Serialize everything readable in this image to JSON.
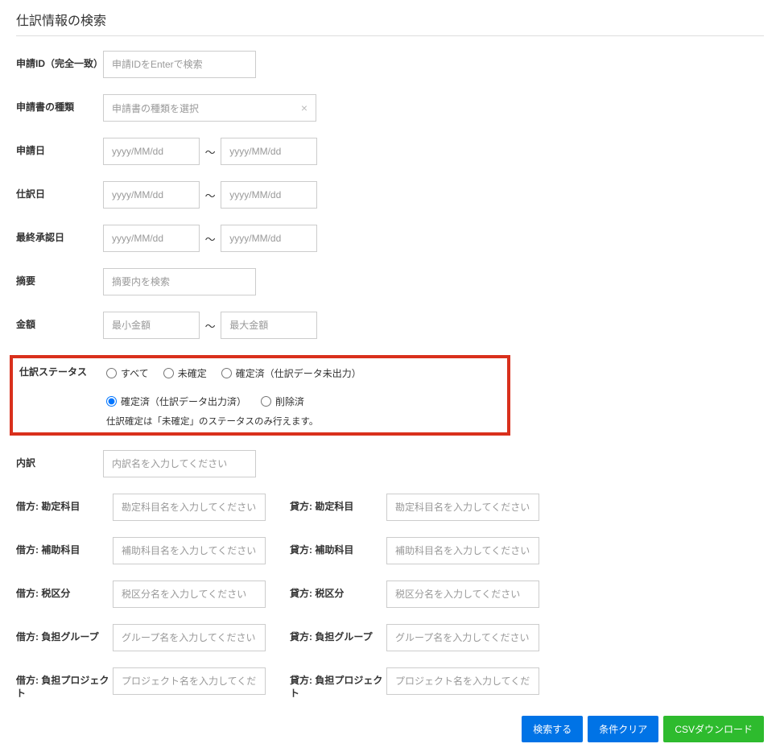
{
  "page_title": "仕訳情報の検索",
  "fields": {
    "request_id": {
      "label": "申請ID（完全一致）",
      "placeholder": "申請IDをEnterで検索"
    },
    "request_type": {
      "label": "申請書の種類",
      "placeholder": "申請書の種類を選択"
    },
    "request_date": {
      "label": "申請日",
      "from_ph": "yyyy/MM/dd",
      "to_ph": "yyyy/MM/dd"
    },
    "journal_date": {
      "label": "仕訳日",
      "from_ph": "yyyy/MM/dd",
      "to_ph": "yyyy/MM/dd"
    },
    "final_approval_date": {
      "label": "最終承認日",
      "from_ph": "yyyy/MM/dd",
      "to_ph": "yyyy/MM/dd"
    },
    "summary": {
      "label": "摘要",
      "placeholder": "摘要内を検索"
    },
    "amount": {
      "label": "金額",
      "min_ph": "最小金額",
      "max_ph": "最大金額"
    },
    "status": {
      "label": "仕訳ステータス",
      "options": {
        "all": "すべて",
        "unconfirmed": "未確定",
        "confirmed_not_exported": "確定済（仕訳データ未出力）",
        "confirmed_exported": "確定済（仕訳データ出力済）",
        "deleted": "削除済"
      },
      "note": "仕訳確定は「未確定」のステータスのみ行えます。"
    },
    "breakdown": {
      "label": "内訳",
      "placeholder": "内訳名を入力してください"
    },
    "debit_account": {
      "label": "借方: 勘定科目",
      "placeholder": "勘定科目名を入力してください"
    },
    "credit_account": {
      "label": "貸方: 勘定科目",
      "placeholder": "勘定科目名を入力してください"
    },
    "debit_subaccount": {
      "label": "借方: 補助科目",
      "placeholder": "補助科目名を入力してください"
    },
    "credit_subaccount": {
      "label": "貸方: 補助科目",
      "placeholder": "補助科目名を入力してください"
    },
    "debit_tax": {
      "label": "借方: 税区分",
      "placeholder": "税区分名を入力してください"
    },
    "credit_tax": {
      "label": "貸方: 税区分",
      "placeholder": "税区分名を入力してください"
    },
    "debit_group": {
      "label": "借方: 負担グループ",
      "placeholder": "グループ名を入力してください"
    },
    "credit_group": {
      "label": "貸方: 負担グループ",
      "placeholder": "グループ名を入力してください"
    },
    "debit_project": {
      "label": "借方: 負担プロジェクト",
      "placeholder": "プロジェクト名を入力してください"
    },
    "credit_project": {
      "label": "貸方: 負担プロジェクト",
      "placeholder": "プロジェクト名を入力してください"
    }
  },
  "range_separator": "～",
  "buttons": {
    "search": "検索する",
    "clear": "条件クリア",
    "csv": "CSVダウンロード"
  }
}
